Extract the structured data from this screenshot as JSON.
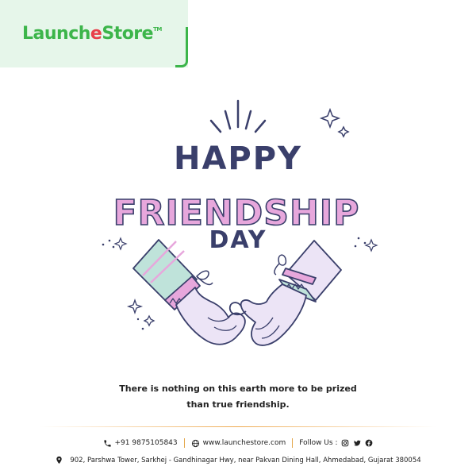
{
  "brand": {
    "launch": "Launch",
    "e": "e",
    "store": "Store",
    "tm": "TM",
    "green": "#3cb54a",
    "red": "#e8404a"
  },
  "headline": {
    "line1": "HAPPY",
    "line2": "FRIENDSHIP",
    "line3": "DAY",
    "navy": "#3a3f6b",
    "pink": "#e7a7dc"
  },
  "quote": {
    "line1": "There is nothing on this earth more to be prized",
    "line2": "than true friendship."
  },
  "footer": {
    "phone": "+91 9875105843",
    "website": "www.launchestore.com",
    "follow": "Follow Us :",
    "address": "902, Parshwa Tower, Sarkhej - Gandhinagar Hwy, near Pakvan Dining Hall, Ahmedabad, Gujarat 380054",
    "icons": [
      "phone-icon",
      "globe-icon",
      "instagram-icon",
      "twitter-icon",
      "facebook-icon",
      "location-pin-icon"
    ],
    "accent": "#e3a64a"
  }
}
